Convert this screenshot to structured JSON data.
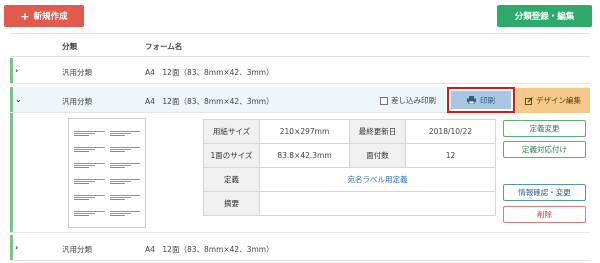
{
  "toolbar": {
    "new_label": "新規作成",
    "category_label": "分類登録・編集"
  },
  "table": {
    "col_category": "分類",
    "col_form_name": "フォーム名"
  },
  "rows": [
    {
      "category": "汎用分類",
      "form_name": "A4　12面（83、8mm×42、3mm）"
    },
    {
      "category": "汎用分類",
      "form_name": "A4　12面（83、8mm×42、3mm）"
    },
    {
      "category": "汎用分類",
      "form_name": "A4　12面（83、8mm×42、3mm）"
    }
  ],
  "expanded": {
    "merge_print_label": "差し込み印刷",
    "merge_print_checked": false,
    "print_label": "印刷",
    "design_edit_label": "デザイン編集"
  },
  "details": {
    "paper_size_label": "用紙サイズ",
    "paper_size_value": "210×297mm",
    "last_updated_label": "最終更新日",
    "last_updated_value": "2018/10/22",
    "face_size_label": "1面のサイズ",
    "face_size_value": "83.8×42.3mm",
    "face_count_label": "面付数",
    "face_count_value": "12",
    "definition_label": "定義",
    "definition_value": "宛名ラベル用定義",
    "summary_label": "摘要",
    "summary_value": ""
  },
  "side_buttons": {
    "definition_change": "定義変更",
    "definition_attach": "定義対応付け",
    "info_check_change": "情報確認・変更",
    "delete": "削除"
  },
  "colors": {
    "new_button": "#e05a4e",
    "category_button": "#2eaa6a",
    "print_button": "#a9c5e0",
    "print_highlight": "#e0151b",
    "design_button": "#f5c98a",
    "row_accent": "#7cc28f"
  }
}
